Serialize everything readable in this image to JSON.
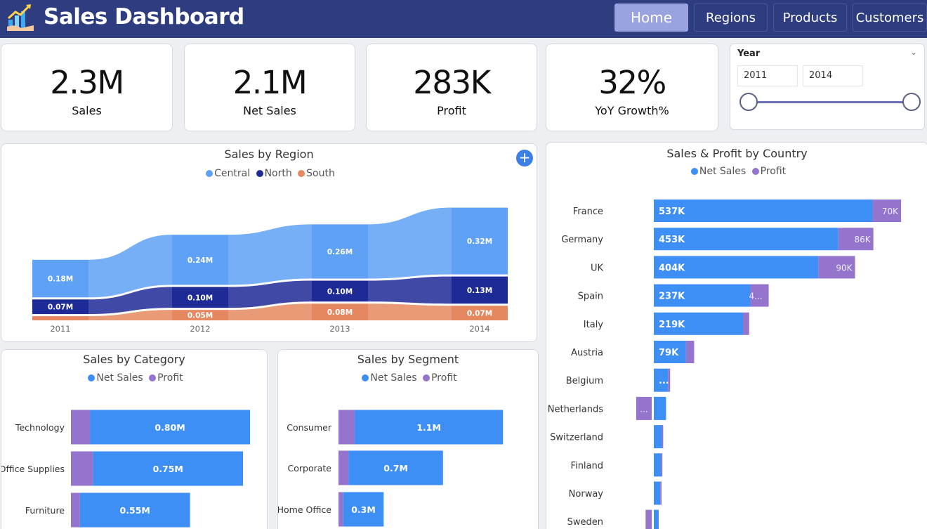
{
  "header": {
    "title": "Sales Dashboard",
    "logo_icon": "growth-chart-icon",
    "nav": [
      {
        "label": "Home",
        "active": true
      },
      {
        "label": "Regions",
        "active": false
      },
      {
        "label": "Products",
        "active": false
      },
      {
        "label": "Customers",
        "active": false
      }
    ]
  },
  "kpis": [
    {
      "value": "2.3M",
      "label": "Sales"
    },
    {
      "value": "2.1M",
      "label": "Net Sales"
    },
    {
      "value": "283K",
      "label": "Profit"
    },
    {
      "value": "32%",
      "label": "YoY Growth%"
    }
  ],
  "slicer": {
    "title": "Year",
    "from": "2011",
    "to": "2014",
    "chevron_icon": "chevron-down-icon"
  },
  "colors": {
    "central": "#5ea1f5",
    "north": "#1e2a96",
    "south": "#e5885f",
    "net_sales": "#3d8ef5",
    "profit": "#9474cc",
    "header_bg": "#2e3c80",
    "nav_active": "#9aa3e0"
  },
  "region_chart": {
    "title": "Sales by Region",
    "add_icon": "plus-icon",
    "legend": [
      "Central",
      "North",
      "South"
    ],
    "chart_data": {
      "type": "area",
      "title": "Sales by Region",
      "categories": [
        "2011",
        "2012",
        "2013",
        "2014"
      ],
      "series": [
        {
          "name": "South",
          "values": [
            0.02,
            0.05,
            0.08,
            0.07
          ],
          "labels": [
            "",
            "0.05M",
            "0.08M",
            "0.07M"
          ]
        },
        {
          "name": "North",
          "values": [
            0.07,
            0.1,
            0.1,
            0.13
          ],
          "labels": [
            "0.07M",
            "0.10M",
            "0.10M",
            "0.13M"
          ]
        },
        {
          "name": "Central",
          "values": [
            0.18,
            0.24,
            0.26,
            0.32
          ],
          "labels": [
            "0.18M",
            "0.24M",
            "0.26M",
            "0.32M"
          ]
        }
      ],
      "stacked": true
    }
  },
  "country_chart": {
    "title": "Sales & Profit by Country",
    "legend": [
      "Net Sales",
      "Profit"
    ],
    "chart_data": {
      "type": "bar",
      "orientation": "horizontal",
      "stacked": true,
      "categories": [
        "France",
        "Germany",
        "UK",
        "Spain",
        "Italy",
        "Austria",
        "Belgium",
        "Netherlands",
        "Switzerland",
        "Finland",
        "Norway",
        "Sweden"
      ],
      "series": [
        {
          "name": "Net Sales",
          "values": [
            537,
            453,
            404,
            237,
            219,
            79,
            35,
            30,
            20,
            18,
            16,
            12
          ],
          "labels": [
            "537K",
            "453K",
            "404K",
            "237K",
            "219K",
            "79K",
            "...",
            "",
            "",
            "",
            "",
            ""
          ]
        },
        {
          "name": "Profit",
          "values": [
            70,
            86,
            90,
            45,
            15,
            20,
            5,
            -38,
            3,
            3,
            3,
            -15
          ],
          "labels": [
            "70K",
            "86K",
            "90K",
            "4...",
            "",
            "",
            "",
            "...",
            "",
            "",
            "",
            ""
          ]
        }
      ],
      "units": "K"
    }
  },
  "category_chart": {
    "title": "Sales by Category",
    "legend": [
      "Net Sales",
      "Profit"
    ],
    "chart_data": {
      "type": "bar",
      "orientation": "horizontal",
      "stacked": true,
      "categories": [
        "Technology",
        "Office Supplies",
        "Furniture"
      ],
      "series": [
        {
          "name": "Profit",
          "values": [
            0.095,
            0.11,
            0.045
          ]
        },
        {
          "name": "Net Sales",
          "values": [
            0.8,
            0.75,
            0.55
          ],
          "labels": [
            "0.80M",
            "0.75M",
            "0.55M"
          ]
        }
      ],
      "units": "M"
    }
  },
  "segment_chart": {
    "title": "Sales by Segment",
    "legend": [
      "Net Sales",
      "Profit"
    ],
    "chart_data": {
      "type": "bar",
      "orientation": "horizontal",
      "stacked": true,
      "categories": [
        "Consumer",
        "Corporate",
        "Home Office"
      ],
      "series": [
        {
          "name": "Profit",
          "values": [
            0.12,
            0.075,
            0.035
          ]
        },
        {
          "name": "Net Sales",
          "values": [
            1.1,
            0.7,
            0.3
          ],
          "labels": [
            "1.1M",
            "0.7M",
            "0.3M"
          ]
        }
      ],
      "units": "M"
    }
  }
}
